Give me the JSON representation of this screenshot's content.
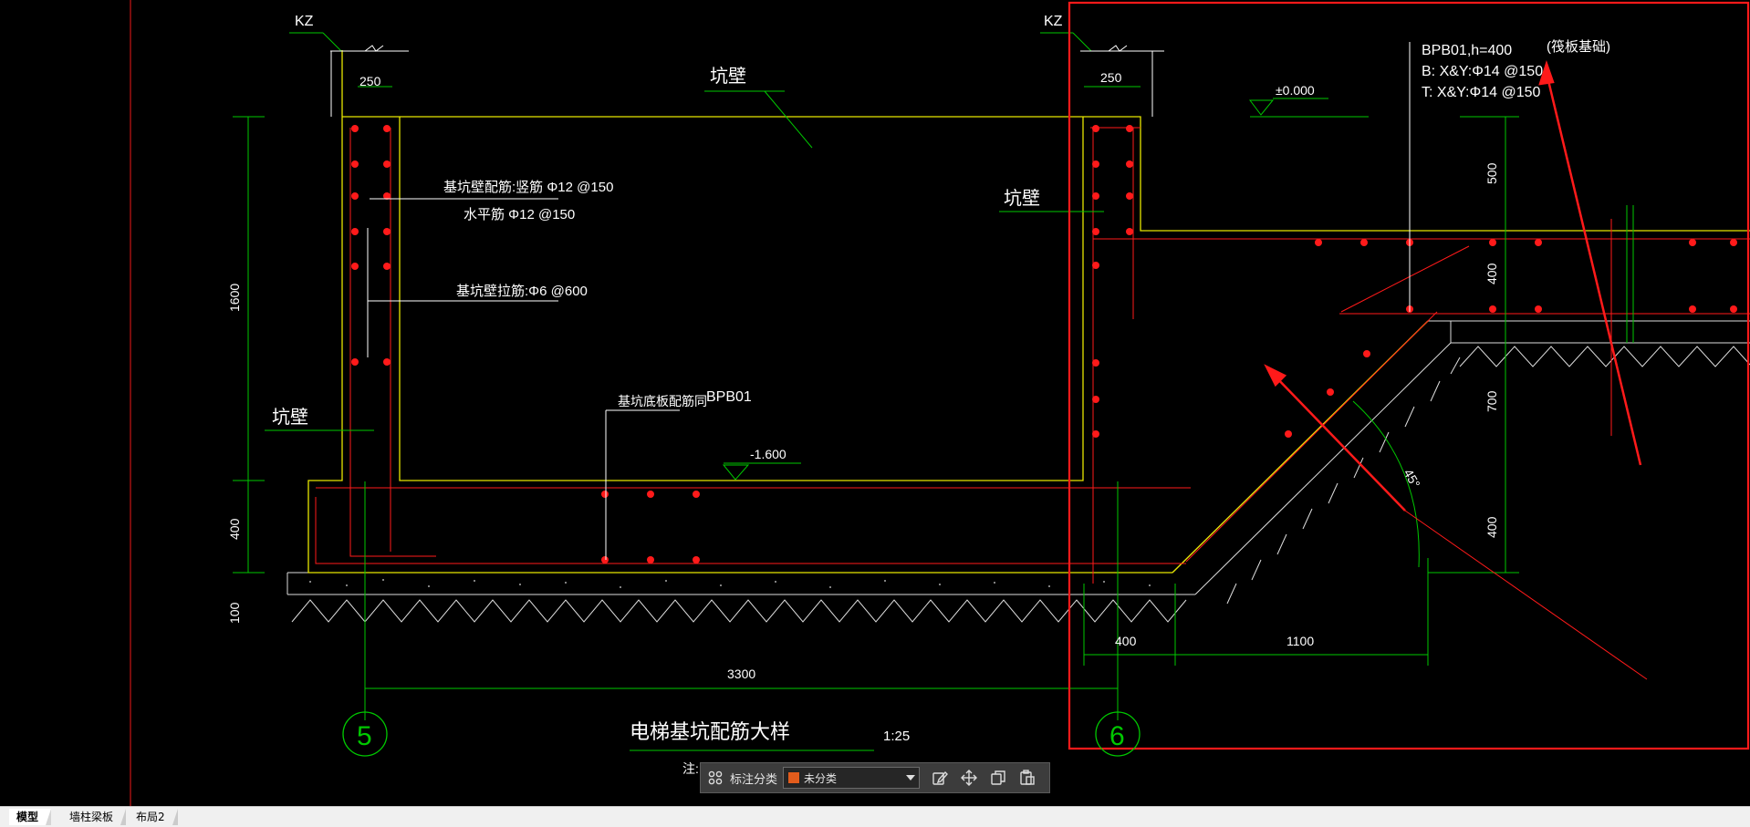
{
  "drawing": {
    "kz_left": "KZ",
    "kz_right": "KZ",
    "dim_250_left": "250",
    "dim_250_right": "250",
    "pit_wall_top": "坑壁",
    "pit_wall_right": "坑壁",
    "pit_wall_left": "坑壁",
    "elev_zero": "±0.000",
    "elev_bottom": "-1.600",
    "slab_title": "BPB01,h=400",
    "slab_b": "B:  X&Y:Φ14 @150",
    "slab_t": "T:  X&Y:Φ14 @150",
    "raft_note": "(筏板基础)",
    "wall_rebar_vertical": "基坑壁配筋:竖筋  Φ12 @150",
    "wall_rebar_horizontal": "水平筋  Φ12 @150",
    "wall_tie": "基坑壁拉筋:Φ6 @600",
    "bottom_slab_note": "基坑底板配筋同",
    "bottom_slab_ref": "BPB01",
    "dim_1600": "1600",
    "dim_400_left": "400",
    "dim_100": "100",
    "dim_500": "500",
    "dim_400_r1": "400",
    "dim_700": "700",
    "dim_400_r2": "400",
    "dim_400_bottom": "400",
    "dim_1100": "1100",
    "dim_3300": "3300",
    "angle": "45°",
    "axis_5": "5",
    "axis_6": "6",
    "title": "电梯基坑配筋大样",
    "scale": "1:25",
    "note_prefix": "注:"
  },
  "toolbar": {
    "grid_icon": "grid-icon",
    "label": "标注分类",
    "select_value": "未分类",
    "swatch_color": "#e25c1c",
    "edit_icon": "edit-icon",
    "move_icon": "move-icon",
    "copy_icon": "copy-icon",
    "paste_icon": "paste-icon"
  },
  "tabs": [
    {
      "label": "模型",
      "active": true
    },
    {
      "label": "墙柱梁板",
      "active": false
    },
    {
      "label": "布局2",
      "active": false
    }
  ],
  "colors": {
    "background": "#000000",
    "green": "#00c800",
    "yellow": "#e6e600",
    "red": "#ff1a1a",
    "white": "#ffffff"
  }
}
